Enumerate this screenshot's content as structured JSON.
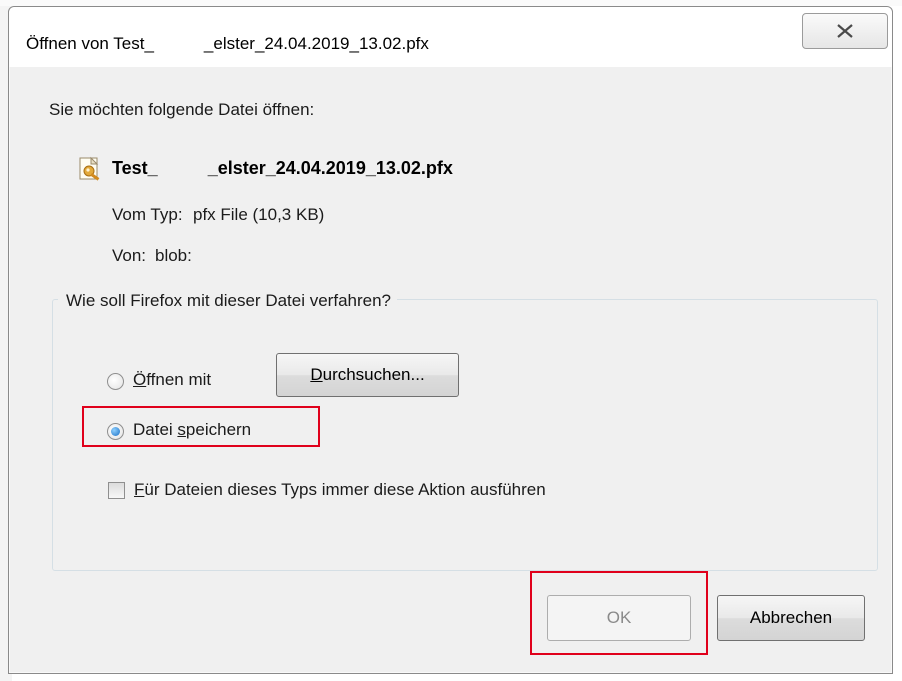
{
  "window": {
    "title_prefix": "Öffnen von Test_",
    "title_suffix": "_elster_24.04.2019_13.02.pfx",
    "close_icon": "close-x-icon"
  },
  "intro": {
    "prompt": "Sie möchten folgende Datei öffnen:",
    "file_icon": "pfx-certificate-file-icon",
    "file_name_prefix": "Test_",
    "file_name_suffix": "_elster_24.04.2019_13.02.pfx",
    "type_label": "Vom Typ:",
    "type_value": "pfx File (10,3 KB)",
    "source_label": "Von:",
    "source_value": "blob:"
  },
  "action_group": {
    "legend": "Wie soll Firefox mit dieser Datei verfahren?",
    "open_with": {
      "mnemonic": "Ö",
      "rest": "ffnen mit",
      "selected": false
    },
    "browse_button": {
      "mnemonic": "D",
      "rest": "urchsuchen..."
    },
    "save_file": {
      "pre": "Datei ",
      "mnemonic": "s",
      "rest": "peichern",
      "selected": true
    },
    "always_checkbox": {
      "mnemonic": "F",
      "rest": "ür Dateien dieses Typs immer diese Aktion ausführen",
      "checked": false
    }
  },
  "buttons": {
    "ok": "OK",
    "ok_enabled": false,
    "cancel": "Abbrechen"
  },
  "colors": {
    "highlight": "#e0001b",
    "dialog_bg": "#f0f0f0"
  }
}
